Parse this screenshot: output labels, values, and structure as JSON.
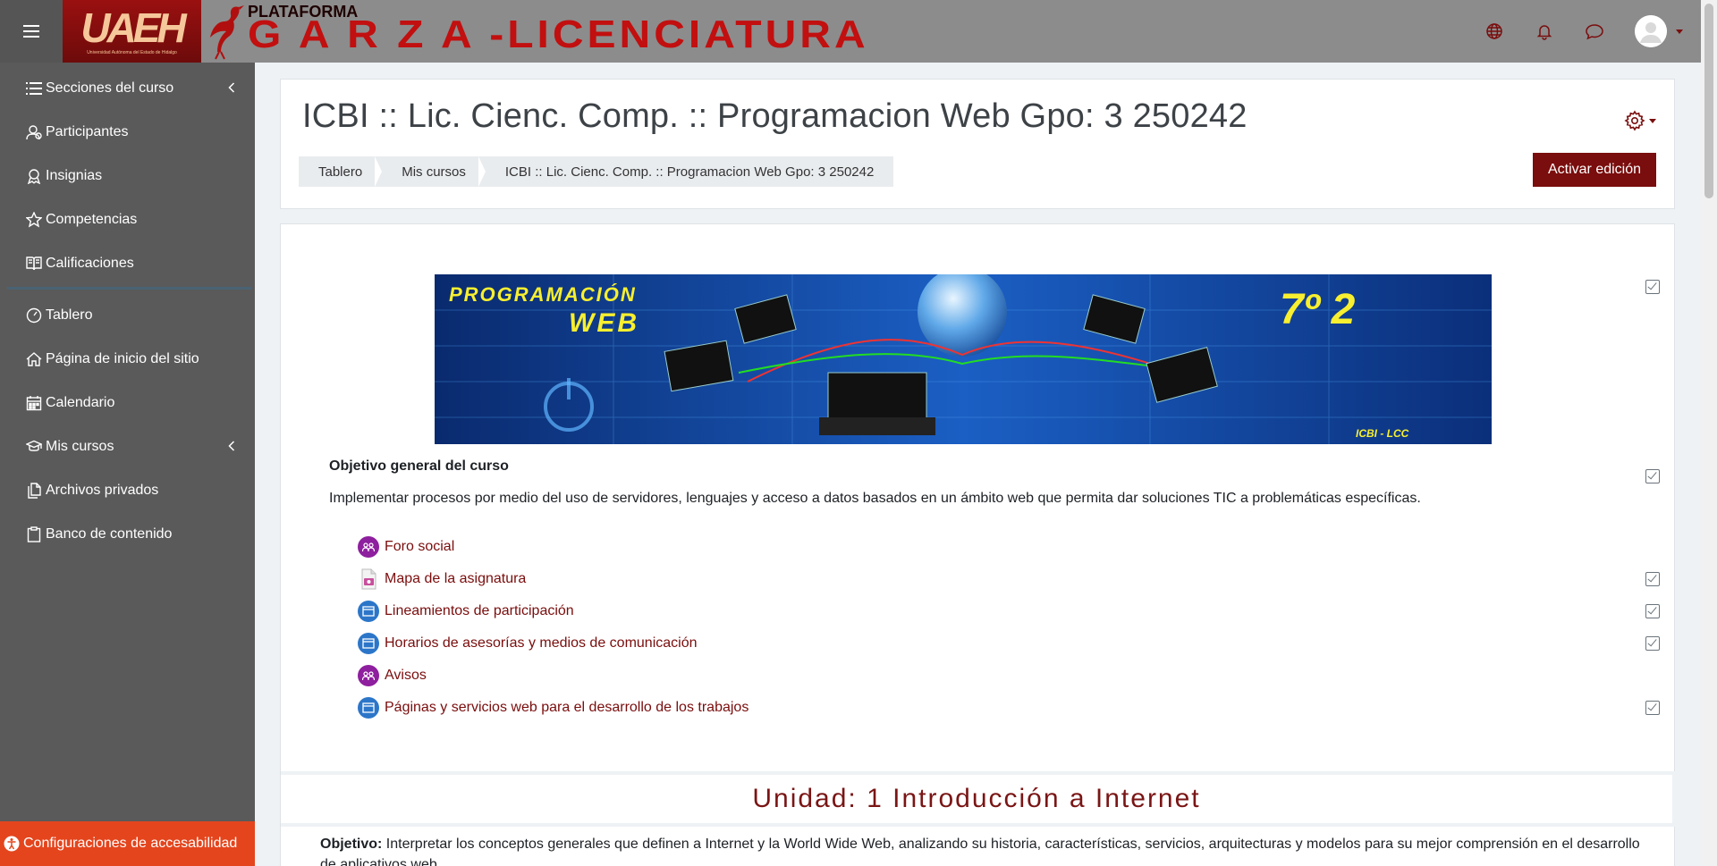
{
  "navbar": {
    "logo_text": "UAEH",
    "logo_sub": "Universidad Autónoma del Estado de Hidalgo",
    "platform_small": "PLATAFORMA",
    "platform_big": "G A R Z A -LICENCIATURA",
    "icons": [
      "globe-icon",
      "bell-icon",
      "chat-icon",
      "user-avatar"
    ]
  },
  "drawer": {
    "items": [
      {
        "label": "Secciones del curso",
        "icon": "list-icon",
        "chevron": true
      },
      {
        "label": "Participantes",
        "icon": "users-icon"
      },
      {
        "label": "Insignias",
        "icon": "badge-icon"
      },
      {
        "label": "Competencias",
        "icon": "star-icon"
      },
      {
        "label": "Calificaciones",
        "icon": "book-icon"
      }
    ],
    "items2": [
      {
        "label": "Tablero",
        "icon": "dashboard-icon"
      },
      {
        "label": "Página de inicio del sitio",
        "icon": "home-icon"
      },
      {
        "label": "Calendario",
        "icon": "calendar-icon"
      },
      {
        "label": "Mis cursos",
        "icon": "graduation-cap-icon",
        "chevron": true
      },
      {
        "label": "Archivos privados",
        "icon": "files-icon"
      },
      {
        "label": "Banco de contenido",
        "icon": "clipboard-icon"
      }
    ],
    "accessibility_label": "Configuraciones de accesabilidad"
  },
  "header": {
    "title": "ICBI :: Lic. Cienc. Comp. :: Programacion Web Gpo: 3 250242",
    "breadcrumb": [
      "Tablero",
      "Mis cursos",
      "ICBI :: Lic. Cienc. Comp. :: Programacion Web Gpo: 3 250242"
    ],
    "edit_button": "Activar edición"
  },
  "banner": {
    "title_line1": "PROGRAMACIÓN",
    "title_line2": "WEB",
    "semester": "7º  2",
    "footer": "ICBI - LCC"
  },
  "section0": {
    "heading": "Objetivo general del curso",
    "text": "Implementar procesos por medio del uso de servidores, lenguajes y acceso a datos basados en un ámbito web que permita dar soluciones TIC a problemáticas específicas.",
    "activities": [
      {
        "label": "Foro social",
        "type": "forum",
        "check": false
      },
      {
        "label": "Mapa de la asignatura",
        "type": "file",
        "check": true
      },
      {
        "label": "Lineamientos de participación",
        "type": "page",
        "check": true
      },
      {
        "label": "Horarios de asesorías y medios de comunicación",
        "type": "page",
        "check": true
      },
      {
        "label": "Avisos",
        "type": "forum",
        "check": false
      },
      {
        "label": "Páginas y servicios web para el desarrollo de los trabajos",
        "type": "page",
        "check": true
      }
    ]
  },
  "unit1": {
    "title": "Unidad: 1 Introducción a Internet",
    "objective_label": "Objetivo:",
    "objective_text": " Interpretar los conceptos generales que definen a Internet y la World Wide Web, analizando su historia, características, servicios, arquitecturas y modelos para su mejor comprensión en el desarrollo de aplicativos web."
  },
  "colors": {
    "brand": "#7a0d0d",
    "navbar_bg": "#8c8c8c",
    "drawer_bg": "#5a5a5a",
    "accessibility_bg": "#e4451d",
    "forum_icon": "#8e1f9e",
    "page_icon": "#2c76c9"
  }
}
